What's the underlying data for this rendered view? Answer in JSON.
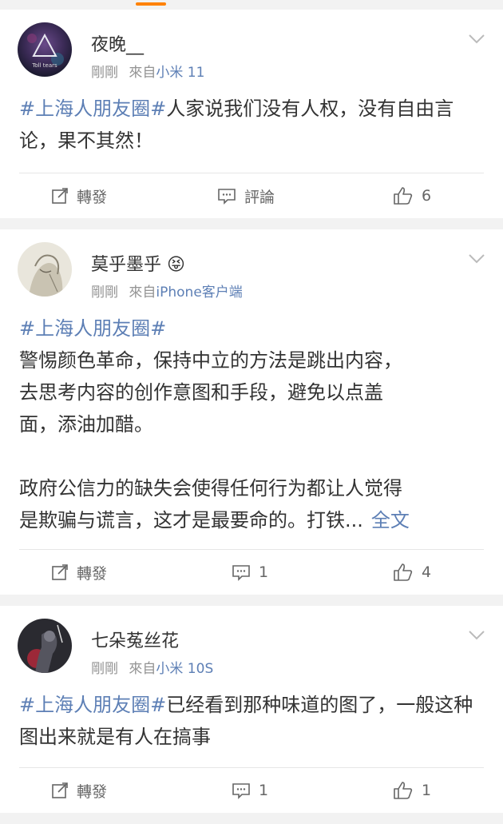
{
  "posts": [
    {
      "username": "夜晚__",
      "time": "剛剛",
      "from_prefix": "來自",
      "source": "小米 11",
      "tag": "#上海人朋友圈#",
      "text": "人家说我们没有人权，没有自由言论，果不其然！",
      "repost_label": "轉發",
      "comment_label": "評論",
      "like_count": "6"
    },
    {
      "username": "莫乎墨乎",
      "emoji": "😝",
      "time": "剛剛",
      "from_prefix": "來自",
      "source": "iPhone客户端",
      "tag": "#上海人朋友圈#",
      "line1": "警惕颜色革命，保持中立的方法是跳出内容，",
      "line2": "去思考内容的创作意图和手段，避免以点盖",
      "line3": "面，添油加醋。",
      "line4": "政府公信力的缺失会使得任何行为都让人觉得",
      "line5": "是欺骗与谎言，这才是最要命的。打铁...",
      "more_label": "全文",
      "repost_label": "轉發",
      "comment_count": "1",
      "like_count": "4"
    },
    {
      "username": "七朵菟丝花",
      "time": "剛剛",
      "from_prefix": "來自",
      "source": "小米 10S",
      "tag": "#上海人朋友圈#",
      "text": "已经看到那种味道的图了，一般这种图出来就是有人在搞事",
      "repost_label": "轉發",
      "comment_count": "1",
      "like_count": "1"
    }
  ],
  "avatar_text": "Toll tears",
  "colors": {
    "accent": "#ff8200",
    "link": "#5d7fb5",
    "meta": "#939393"
  },
  "icons": [
    "chevron-down-icon",
    "repost-icon",
    "comment-icon",
    "like-icon"
  ]
}
